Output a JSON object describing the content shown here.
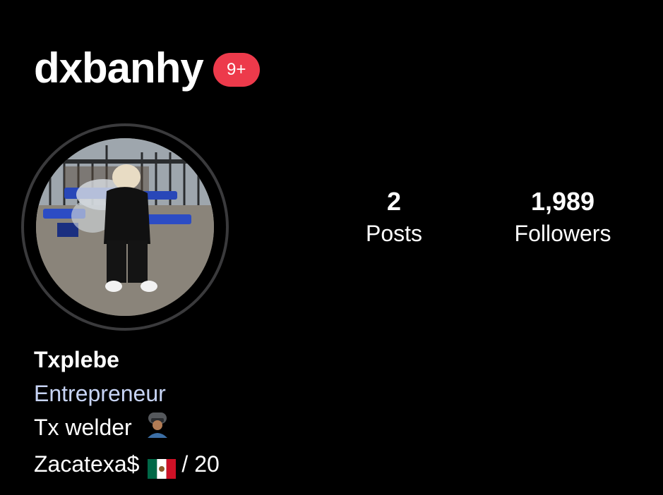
{
  "profile": {
    "username": "dxbanhy",
    "notification_badge": "9+",
    "badge_color": "#ed3a4b"
  },
  "stats": {
    "posts_count": "2",
    "posts_label": "Posts",
    "followers_count": "1,989",
    "followers_label": "Followers"
  },
  "bio": {
    "name": "Txplebe",
    "category": "Entrepreneur",
    "line1_text": "Tx welder",
    "line1_emoji": "welder-emoji-icon",
    "line2_text": "Zacatexa$",
    "line2_flag": "mexico-flag-icon",
    "line2_suffix": "/ 20"
  }
}
